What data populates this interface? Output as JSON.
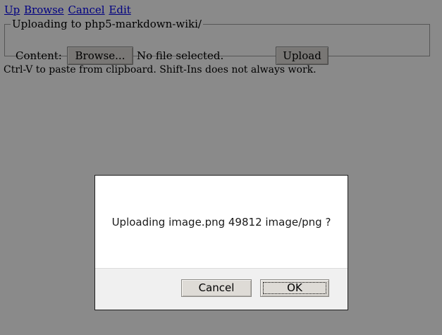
{
  "nav": {
    "links": [
      "Up",
      "Browse",
      "Cancel",
      "Edit"
    ]
  },
  "upload_form": {
    "legend": "Uploading to php5-markdown-wiki/",
    "content_label": "Content:",
    "browse_label": "Browse...",
    "file_status": "No file selected.",
    "upload_label": "Upload",
    "hint": "Ctrl-V to paste from clipboard. Shift-Ins does not always work."
  },
  "dialog": {
    "message": "Uploading image.png 49812 image/png ?",
    "cancel_label": "Cancel",
    "ok_label": "OK"
  },
  "colors": {
    "link": "#0000ee",
    "overlay": "rgba(0,0,0,0.46)",
    "button_face": "#e0ddd8"
  }
}
